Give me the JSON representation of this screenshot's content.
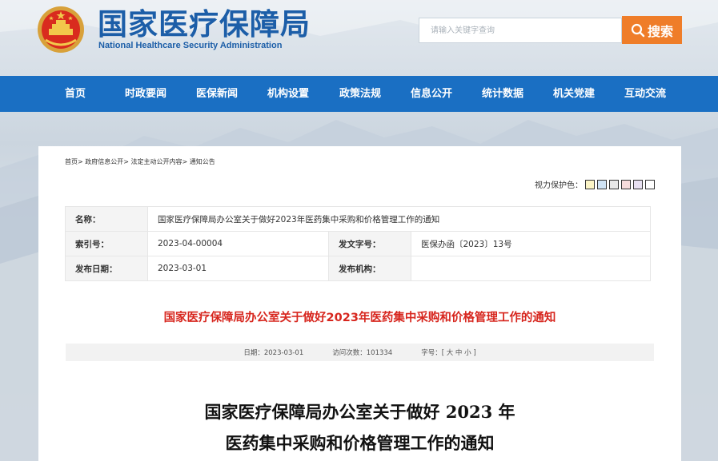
{
  "header": {
    "title_cn": "国家医疗保障局",
    "title_en": "National Healthcare Security Administration",
    "search_placeholder": "请输入关键字查询",
    "search_label": "搜索"
  },
  "nav": {
    "items": [
      "首页",
      "时政要闻",
      "医保新闻",
      "机构设置",
      "政策法规",
      "信息公开",
      "统计数据",
      "机关党建",
      "互动交流"
    ]
  },
  "breadcrumb": "首页> 政府信息公开> 法定主动公开内容> 通知公告",
  "eye_care": {
    "label": "视力保护色：",
    "colors": [
      "#fbf4c6",
      "#cfe3f5",
      "#e8e8e8",
      "#f7dcdc",
      "#e8e1f2",
      "#ffffff"
    ]
  },
  "meta": {
    "name_label": "名称：",
    "name_value": "国家医疗保障局办公室关于做好2023年医药集中采购和价格管理工作的通知",
    "index_label": "索引号：",
    "index_value": "2023-04-00004",
    "docno_label": "发文字号：",
    "docno_value": "医保办函〔2023〕13号",
    "date_label": "发布日期：",
    "date_value": "2023-03-01",
    "org_label": "发布机构：",
    "org_value": ""
  },
  "article": {
    "title_red": "国家医疗保障局办公室关于做好2023年医药集中采购和价格管理工作的通知",
    "info_date": "日期：2023-03-01",
    "info_views": "访问次数：101334",
    "info_fontsize": "字号：[ 大 中 小 ]",
    "doc_title_line1": "国家医疗保障局办公室关于做好 2023 年",
    "doc_title_line2": "医药集中采购和价格管理工作的通知"
  }
}
